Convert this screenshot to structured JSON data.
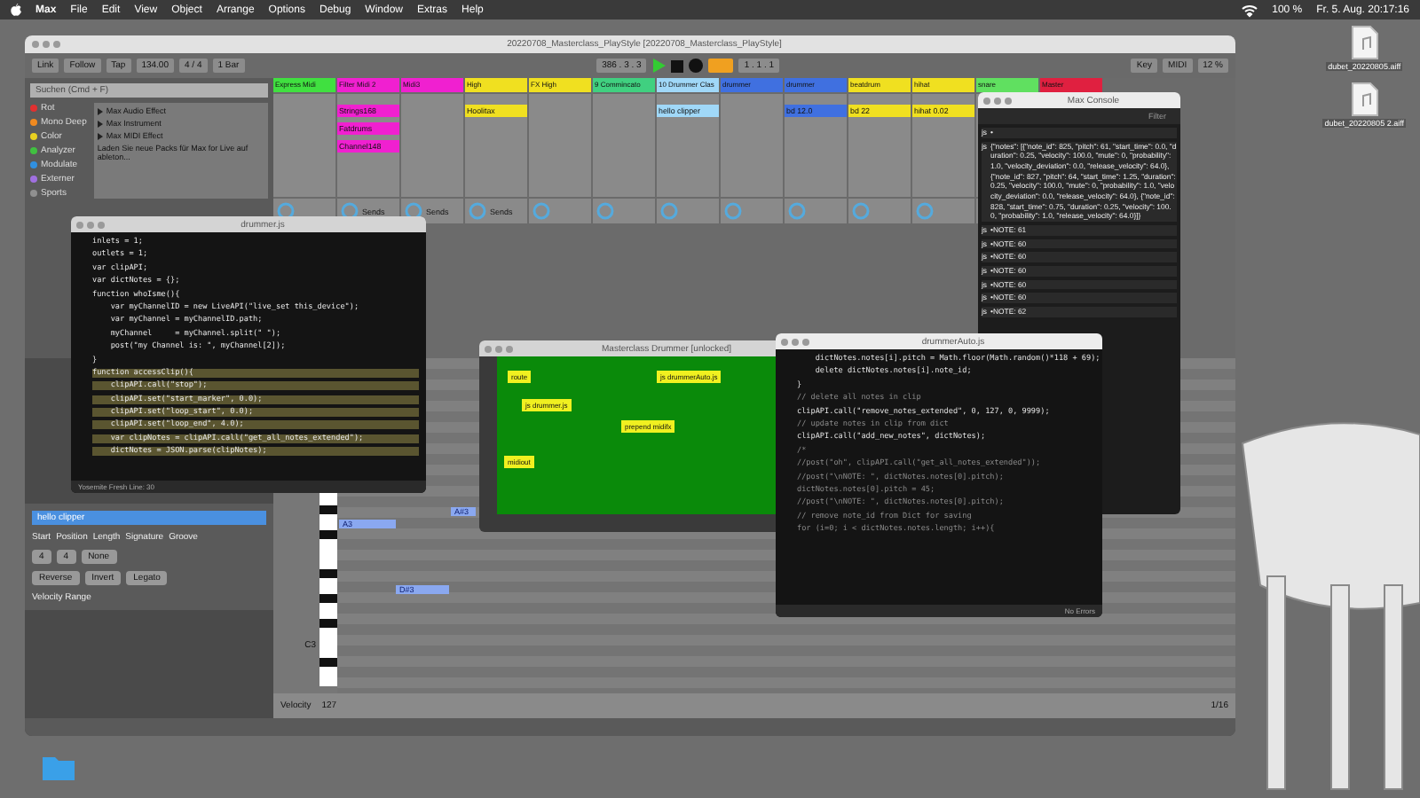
{
  "menubar": {
    "app": "Max",
    "items": [
      "File",
      "Edit",
      "View",
      "Object",
      "Arrange",
      "Options",
      "Debug",
      "Window",
      "Extras",
      "Help"
    ],
    "battery": "100 %",
    "clock": "Fr. 5. Aug. 20:17:16"
  },
  "desktop_icons": [
    {
      "label": "dubet_20220805.aiff"
    },
    {
      "label": "dubet_20220805 2.aiff"
    }
  ],
  "live": {
    "title": "20220708_Masterclass_PlayStyle [20220708_Masterclass_PlayStyle]",
    "controls": [
      "Link",
      "Follow",
      "Tap",
      "134.00",
      "4 / 4",
      "1 Bar"
    ],
    "position": "386 . 3 . 3",
    "loop": "1 . 1 . 1",
    "right_controls": [
      "Key",
      "MIDI",
      "12 %"
    ],
    "browser": {
      "search": "Suchen (Cmd + F)",
      "collections": [
        {
          "label": "Rot",
          "color": "#e03030"
        },
        {
          "label": "Mono Deep",
          "color": "#f08a20"
        },
        {
          "label": "Color",
          "color": "#e8d020"
        },
        {
          "label": "Analyzer",
          "color": "#40c040"
        },
        {
          "label": "Modulate",
          "color": "#3090e0"
        },
        {
          "label": "Externer",
          "color": "#a070e0"
        },
        {
          "label": "Sports",
          "color": "#909090"
        }
      ],
      "items": [
        "Max Audio Effect",
        "Max Instrument",
        "Max MIDI Effect"
      ],
      "hint": "Laden Sie neue Packs für Max for Live auf ableton..."
    },
    "tracks": [
      {
        "name": "Express Midi",
        "color": "#40e040"
      },
      {
        "name": "Filter Midi 2",
        "color": "#f020d0",
        "clips": [
          "Strings168",
          "Fatdrums",
          "Channel148"
        ],
        "sends": "Sends"
      },
      {
        "name": "Midi3",
        "color": "#f020d0",
        "sends": "Sends"
      },
      {
        "name": "High",
        "color": "#f0e020",
        "clips": [
          "Hoolitax"
        ],
        "sends": "Sends"
      },
      {
        "name": "FX High",
        "color": "#f0e020"
      },
      {
        "name": "9 Commincato",
        "color": "#40d080"
      },
      {
        "name": "10 Drummer Clas",
        "color": "#a0d8f8",
        "clips": [
          "hello clipper"
        ]
      },
      {
        "name": "drummer",
        "color": "#4070e0"
      },
      {
        "name": "drummer",
        "color": "#4070e0",
        "clips": [
          "bd 12.0"
        ]
      },
      {
        "name": "beatdrum",
        "color": "#f0e020",
        "clips": [
          "bd 22"
        ]
      },
      {
        "name": "hihat",
        "color": "#f0e020",
        "clips": [
          "hihat 0.02"
        ]
      },
      {
        "name": "snare",
        "color": "#60e060"
      },
      {
        "name": "Master",
        "color": "#e02040"
      }
    ],
    "clip_panel": {
      "title": "hello clipper",
      "fields": [
        "Start",
        "Position",
        "Length",
        "Signature",
        "Groove"
      ],
      "buttons": [
        "Reverse",
        "Invert",
        "Legato"
      ],
      "velocity_range": "Velocity Range",
      "groove": "None",
      "signature": [
        "4",
        "4"
      ]
    },
    "piano_roll": {
      "key_label": "C3",
      "notes": [
        "A3",
        "A#3",
        "D#3"
      ],
      "velocity_label": "Velocity",
      "velocity_max": "127",
      "grid": "1/16"
    }
  },
  "editor": {
    "title": "drummer.js",
    "status": "Yosemite Fresh Line: 30",
    "lines": [
      {
        "text": "inlets = 1;",
        "selected": false
      },
      {
        "text": "outlets = 1;",
        "selected": false
      },
      {
        "text": "var clipAPI;",
        "selected": false
      },
      {
        "text": "var dictNotes = {};",
        "selected": false
      },
      {
        "text": "function whoIsme(){",
        "selected": false
      },
      {
        "text": "    var myChannelID = new LiveAPI(\"live_set this_device\");",
        "selected": false
      },
      {
        "text": "    var myChannel = myChannelID.path;",
        "selected": false
      },
      {
        "text": "    myChannel     = myChannel.split(\" \");",
        "selected": false
      },
      {
        "text": "    post(\"my Channel is: \", myChannel[2]);",
        "selected": false
      },
      {
        "text": "}",
        "selected": false
      },
      {
        "text": "function accessClip(){",
        "selected": true
      },
      {
        "text": "    clipAPI.call(\"stop\");",
        "selected": true
      },
      {
        "text": "    clipAPI.set(\"start_marker\", 0.0);",
        "selected": true
      },
      {
        "text": "    clipAPI.set(\"loop_start\", 0.0);",
        "selected": true
      },
      {
        "text": "    clipAPI.set(\"loop_end\", 4.0);",
        "selected": true
      },
      {
        "text": "    var clipNotes = clipAPI.call(\"get_all_notes_extended\");",
        "selected": true
      },
      {
        "text": "    dictNotes = JSON.parse(clipNotes);",
        "selected": true
      }
    ]
  },
  "patcher": {
    "title": "Masterclass Drummer [unlocked]",
    "objects": [
      "route",
      "js drummerAuto.js",
      "js drummer.js",
      "prepend midifx",
      "midiout"
    ]
  },
  "console": {
    "title": "Max Console",
    "search": "Filter",
    "entries": [
      {
        "source": "js",
        "text": "•"
      },
      {
        "source": "js",
        "text": "{\"notes\": [{\"note_id\": 825, \"pitch\": 61, \"start_time\": 0.0, \"duration\": 0.25, \"velocity\": 100.0, \"mute\": 0, \"probability\": 1.0, \"velocity_deviation\": 0.0, \"release_velocity\": 64.0}, {\"note_id\": 827, \"pitch\": 64, \"start_time\": 1.25, \"duration\": 0.25, \"velocity\": 100.0, \"mute\": 0, \"probability\": 1.0, \"velocity_deviation\": 0.0, \"release_velocity\": 64.0}, {\"note_id\": 828, \"start_time\": 0.75, \"duration\": 0.25, \"velocity\": 100.0, \"probability\": 1.0, \"release_velocity\": 64.0}]}"
      },
      {
        "source": "js",
        "text": "•NOTE: 61"
      },
      {
        "source": "js",
        "text": "•NOTE: 60"
      },
      {
        "source": "js",
        "text": "•NOTE: 60"
      },
      {
        "source": "js",
        "text": "•NOTE: 60"
      },
      {
        "source": "js",
        "text": "•NOTE: 60"
      },
      {
        "source": "js",
        "text": "•NOTE: 60"
      },
      {
        "source": "js",
        "text": "•NOTE: 62"
      }
    ]
  },
  "editor2": {
    "title": "drummerAuto.js",
    "status": "No Errors",
    "lines": [
      {
        "text": "    dictNotes.notes[i].pitch = Math.floor(Math.random()*118 + 69);",
        "kind": "code"
      },
      {
        "text": "    delete dictNotes.notes[i].note_id;",
        "kind": "code"
      },
      {
        "text": "}",
        "kind": "code"
      },
      {
        "text": "// delete all notes in clip",
        "kind": "comment"
      },
      {
        "text": "clipAPI.call(\"remove_notes_extended\", 0, 127, 0, 9999);",
        "kind": "code"
      },
      {
        "text": "// update notes in clip from dict",
        "kind": "comment"
      },
      {
        "text": "clipAPI.call(\"add_new_notes\", dictNotes);",
        "kind": "code"
      },
      {
        "text": "/*",
        "kind": "comment"
      },
      {
        "text": "//post(\"oh\", clipAPI.call(\"get_all_notes_extended\"));",
        "kind": "comment"
      },
      {
        "text": "//post(\"\\nNOTE: \", dictNotes.notes[0].pitch);",
        "kind": "comment"
      },
      {
        "text": "dictNotes.notes[0].pitch = 45;",
        "kind": "comment"
      },
      {
        "text": "//post(\"\\nNOTE: \", dictNotes.notes[0].pitch);",
        "kind": "comment"
      },
      {
        "text": "// remove note_id from Dict for saving",
        "kind": "comment"
      },
      {
        "text": "for (i=0; i < dictNotes.notes.length; i++){",
        "kind": "comment"
      }
    ]
  }
}
